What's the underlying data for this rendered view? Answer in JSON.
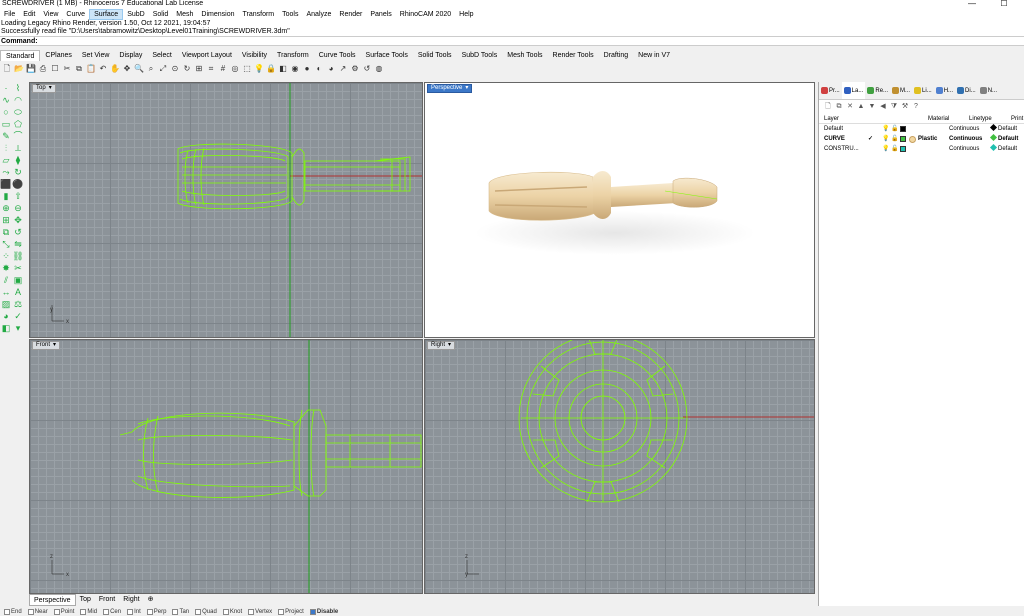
{
  "window": {
    "title": "SCREWDRIVER (1 MB) - Rhinoceros 7 Educational Lab License",
    "minimize_glyph": "—",
    "maximize_glyph": "☐"
  },
  "menu": [
    "File",
    "Edit",
    "View",
    "Curve",
    "Surface",
    "SubD",
    "Solid",
    "Mesh",
    "Dimension",
    "Transform",
    "Tools",
    "Analyze",
    "Render",
    "Panels",
    "RhinoCAM 2020",
    "Help"
  ],
  "menu_active": "Surface",
  "history": [
    "Loading Legacy Rhino Render, version 1.50, Oct 12 2021, 19:04:57",
    "Successfully read file \"D:\\Users\\tabramowitz\\Desktop\\Level01Training\\SCREWDRIVER.3dm\""
  ],
  "command": {
    "label": "Command:",
    "value": ""
  },
  "toolbar_tabs": [
    "Standard",
    "CPlanes",
    "Set View",
    "Display",
    "Select",
    "Viewport Layout",
    "Visibility",
    "Transform",
    "Curve Tools",
    "Surface Tools",
    "Solid Tools",
    "SubD Tools",
    "Mesh Tools",
    "Render Tools",
    "Drafting",
    "New in V7"
  ],
  "toolbar_active": "Standard",
  "viewports": {
    "top": {
      "label": "Top",
      "axis_x": "x",
      "axis_y": "y"
    },
    "perspective": {
      "label": "Perspective"
    },
    "front": {
      "label": "Front",
      "axis_x": "x",
      "axis_y": "z"
    },
    "right": {
      "label": "Right",
      "axis_x": "y",
      "axis_y": "z"
    }
  },
  "viewport_tabs": [
    "Perspective",
    "Top",
    "Front",
    "Right"
  ],
  "viewport_tab_active": "Perspective",
  "viewport_tab_add": "⊕",
  "osnaps": [
    {
      "label": "End",
      "checked": false
    },
    {
      "label": "Near",
      "checked": false
    },
    {
      "label": "Point",
      "checked": false
    },
    {
      "label": "Mid",
      "checked": false
    },
    {
      "label": "Cen",
      "checked": false
    },
    {
      "label": "Int",
      "checked": false
    },
    {
      "label": "Perp",
      "checked": false
    },
    {
      "label": "Tan",
      "checked": false
    },
    {
      "label": "Quad",
      "checked": false
    },
    {
      "label": "Knot",
      "checked": false
    },
    {
      "label": "Vertex",
      "checked": false
    },
    {
      "label": "Project",
      "checked": false
    }
  ],
  "osnap_disable": "Disable",
  "panel": {
    "tabs": [
      {
        "label": "Pr...",
        "color": "#d04040"
      },
      {
        "label": "La...",
        "color": "#3060c0"
      },
      {
        "label": "Re...",
        "color": "#40a040"
      },
      {
        "label": "M...",
        "color": "#c09030"
      },
      {
        "label": "Li...",
        "color": "#e0c020"
      },
      {
        "label": "H...",
        "color": "#5080d0"
      },
      {
        "label": "Di...",
        "color": "#3070b0"
      },
      {
        "label": "N...",
        "color": "#808080"
      }
    ],
    "active_tab": "La...",
    "columns": [
      "Layer",
      "",
      "",
      "Material",
      "Linetype",
      "Print Wi"
    ],
    "layers": [
      {
        "name": "Default",
        "current": "",
        "color": "#000000",
        "material": "",
        "linetype": "Continuous",
        "print": "Default",
        "print_color": "#000000",
        "bold": false
      },
      {
        "name": "CURVE",
        "current": "✓",
        "color": "#40c040",
        "material": "Plastic",
        "linetype": "Continuous",
        "print": "Default",
        "print_color": "#40c040",
        "bold": true
      },
      {
        "name": "CONSTRU...",
        "current": "",
        "color": "#20c0b0",
        "material": "",
        "linetype": "Continuous",
        "print": "Default",
        "print_color": "#20c0b0",
        "bold": false
      }
    ]
  },
  "colors": {
    "wire": "#7fff00",
    "axis_red": "#b03030",
    "axis_green": "#20a020",
    "handle": "#f2ddb4"
  }
}
